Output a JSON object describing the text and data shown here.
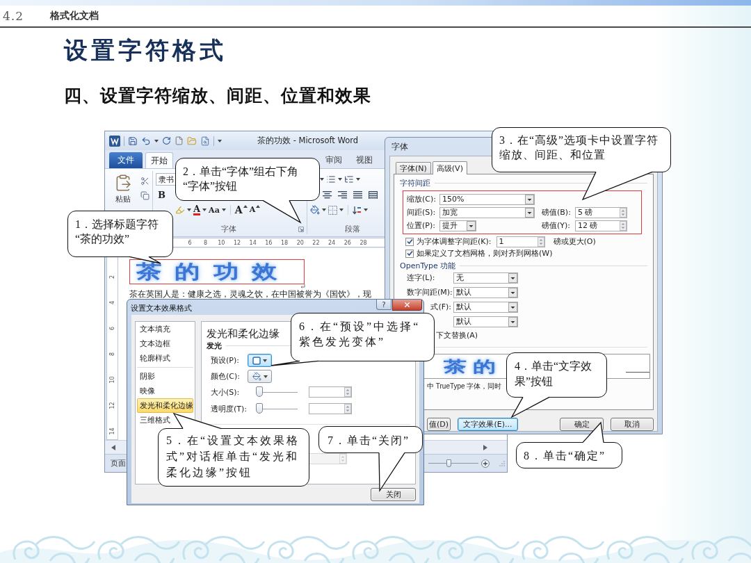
{
  "header": {
    "section": "4.2",
    "chapter": "格式化文档"
  },
  "title": "设置字符格式",
  "subtitle": "四、设置字符缩放、间距、位置和效果",
  "word_window": {
    "title": "茶的功效 - Microsoft Word",
    "tabs": [
      {
        "label": "文件",
        "kind": "file",
        "selected": false
      },
      {
        "label": "开始",
        "kind": "tab",
        "selected": true
      },
      {
        "label": "审阅",
        "kind": "tab",
        "selected": false
      },
      {
        "label": "视图",
        "kind": "tab",
        "selected": false
      }
    ],
    "paste": "粘贴",
    "font_name": "隶书",
    "bold": "B",
    "font_color": "A",
    "change_case": "Aa",
    "grow_font": "A",
    "shrink_font": "A",
    "groups": [
      "字体",
      "段落"
    ],
    "ruler_marks": [
      "6",
      "8",
      "10",
      "12",
      "14",
      "16",
      "18",
      "20",
      "22",
      "24",
      "26",
      "28"
    ],
    "vertical_ruler_marks": [
      "2",
      "4",
      "6",
      "8",
      "10",
      "12",
      "14"
    ],
    "heading": "茶的功效",
    "body": "茶在英国人是：健康之选，灵魂之饮，在中国被誉为《国饮》，现",
    "status": "页面",
    "zoom": {
      "level": 0.4
    }
  },
  "font_dialog": {
    "title": "字体",
    "tabs": [
      {
        "label": "字体(N)",
        "selected": false
      },
      {
        "label": "高级(V)",
        "selected": true
      }
    ],
    "spacing_heading": "字符间距",
    "char_rows": [
      {
        "label": "缩放(C):",
        "value": "150%",
        "kind": "wide"
      },
      {
        "label": "间距(S):",
        "value": "加宽",
        "kind": "wide",
        "by_label": "磅值(B):",
        "by_value": "5 磅"
      },
      {
        "label": "位置(P):",
        "value": "提升",
        "kind": "narrow",
        "by_label": "磅值(Y):",
        "by_value": "12 磅"
      }
    ],
    "kerning": {
      "label": "为字体调整字间距(K):",
      "checked": true,
      "value": "1",
      "suffix": "磅或更大(O)"
    },
    "grid": {
      "label": "如果定义了文档网格，则对齐到网格(W)",
      "checked": true
    },
    "opentype_heading": "OpenType 功能",
    "opentype_rows": [
      {
        "label": "连字(L):",
        "value": "无",
        "kind": "full"
      },
      {
        "label": "数字间距(M):",
        "value": "默认",
        "kind": "full"
      },
      {
        "label": "式(F):",
        "value": "默认",
        "kind": "clipped"
      },
      {
        "value": "默认",
        "kind": "clipped"
      }
    ],
    "contextual": "下文替换(A)",
    "preview": "茶的",
    "note": "中 TrueType 字体，同时",
    "buttons": [
      {
        "label": "值(D)",
        "kind": "default",
        "focused": false
      },
      {
        "label": "文字效果(E)...",
        "kind": "effects",
        "focused": true
      },
      {
        "label": "确定",
        "kind": "ok",
        "focused": false
      },
      {
        "label": "取消",
        "kind": "cancel",
        "focused": false
      }
    ]
  },
  "effects_dialog": {
    "title": "设置文本效果格式",
    "help": "?",
    "categories": [
      {
        "label": "文本填充",
        "selected": false
      },
      {
        "label": "文本边框",
        "selected": false
      },
      {
        "label": "轮廓样式",
        "selected": false
      },
      {
        "label": "阴影",
        "selected": false
      },
      {
        "label": "映像",
        "selected": false
      },
      {
        "label": "发光和柔化边缘",
        "selected": true
      },
      {
        "label": "三维格式",
        "selected": false
      }
    ],
    "panel_heading": "发光和柔化边缘",
    "glow_heading": "发光",
    "preset": {
      "label": "预设(P):",
      "active": true
    },
    "color": {
      "label": "颜色(C):",
      "active": false
    },
    "sliders": [
      {
        "label": "大小(S):",
        "level": 0
      },
      {
        "label": "透明度(T):",
        "level": 0
      }
    ],
    "lower_spin": {
      "disabled": true
    },
    "close": "关闭"
  },
  "callouts": [
    {
      "text": "1．选择标题字符“茶的功效”"
    },
    {
      "text": "2．单击“字体”组右下角“字体”按钮"
    },
    {
      "text": "3．在“高级”选项卡中设置字符缩放、间距、和位置"
    },
    {
      "text": "4．单击“文字效果”按钮"
    },
    {
      "text": "5．在“设置文本效果格式”对话框单击“发光和柔化边缘”按钮"
    },
    {
      "text": "6．在“预设”中选择“紫色发光变体”"
    },
    {
      "text": "7．单击“关闭”"
    },
    {
      "text": "8．单击“确定”"
    }
  ]
}
